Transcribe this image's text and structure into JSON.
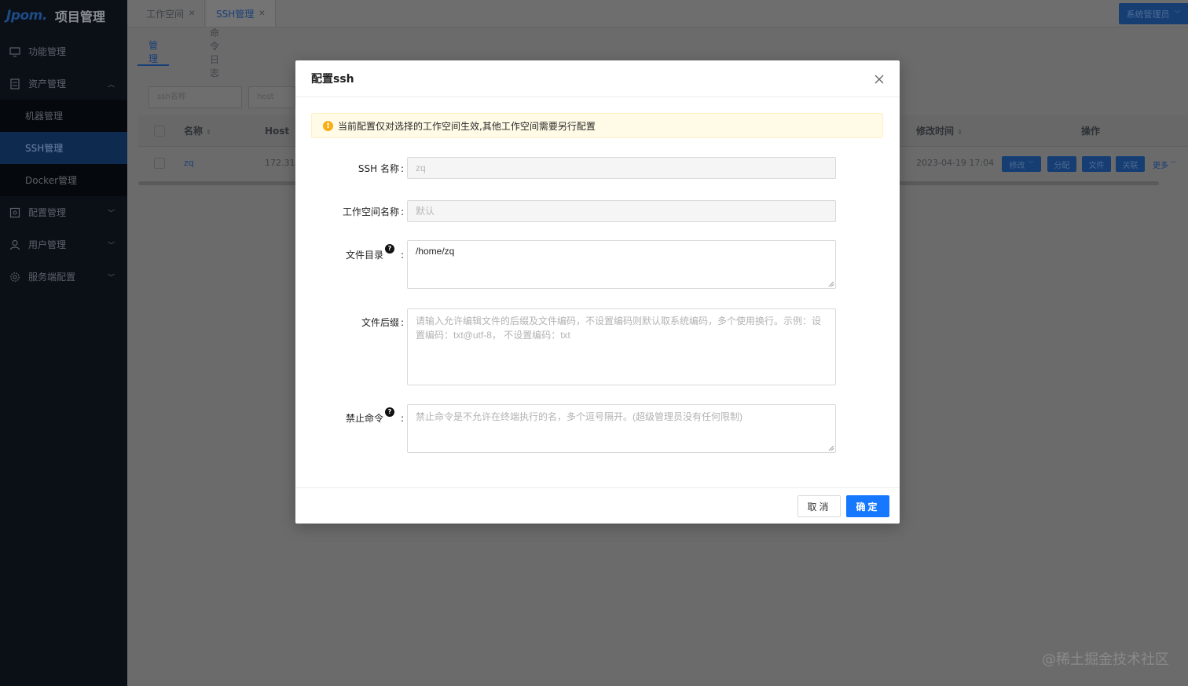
{
  "sidebar": {
    "logo": "Jpom.",
    "title": "项目管理",
    "menu": [
      {
        "label": "功能管理",
        "icon": "monitor-icon"
      },
      {
        "label": "资产管理",
        "icon": "server-icon"
      },
      {
        "label": "机器管理"
      },
      {
        "label": "SSH管理"
      },
      {
        "label": "Docker管理"
      },
      {
        "label": "配置管理",
        "icon": "config-icon"
      },
      {
        "label": "用户管理",
        "icon": "user-icon"
      },
      {
        "label": "服务端配置",
        "icon": "settings-icon"
      }
    ]
  },
  "topbar": {
    "tabs": [
      {
        "label": "工作空间"
      },
      {
        "label": "SSH管理"
      }
    ],
    "user_button": "系统管理员"
  },
  "page": {
    "subtabs": [
      "管理",
      "命令日志"
    ],
    "filters": {
      "ssh_name_placeholder": "ssh名称",
      "host_placeholder": "host"
    },
    "table": {
      "headers": {
        "name": "名称",
        "host": "Host",
        "modified": "修改时间",
        "actions": "操作"
      },
      "row": {
        "name": "zq",
        "host": "172.31",
        "modified": "2023-04-19 17:04"
      },
      "actions": [
        "修改",
        "分配",
        "文件",
        "关联",
        "更多"
      ]
    }
  },
  "modal": {
    "title": "配置ssh",
    "alert": "当前配置仅对选择的工作空间生效,其他工作空间需要另行配置",
    "fields": {
      "ssh_name": {
        "label": "SSH 名称",
        "value": "zq"
      },
      "workspace": {
        "label": "工作空间名称",
        "value": "默认"
      },
      "file_dir": {
        "label": "文件目录",
        "value": "/home/zq"
      },
      "file_suffix": {
        "label": "文件后缀",
        "placeholder": "请输入允许编辑文件的后缀及文件编码，不设置编码则默认取系统编码，多个使用换行。示例：设置编码：txt@utf-8， 不设置编码：txt"
      },
      "forbid_cmd": {
        "label": "禁止命令",
        "placeholder": "禁止命令是不允许在终端执行的名，多个逗号隔开。(超级管理员没有任何限制)"
      }
    },
    "buttons": {
      "cancel": "取消",
      "ok": "确定"
    }
  },
  "watermark": "@稀土掘金技术社区",
  "colors": {
    "primary": "#1677ff",
    "alert_bg": "#fffbe6",
    "warning": "#faad14",
    "sidebar_bg": "#0b1017"
  }
}
